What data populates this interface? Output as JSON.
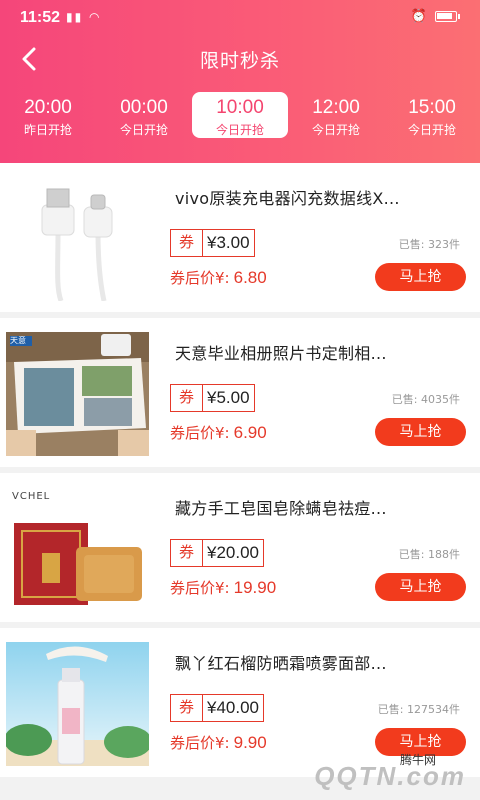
{
  "status_bar": {
    "time": "11:52",
    "signal_icons": "▮▮ ◠"
  },
  "header": {
    "title": "限时秒杀"
  },
  "tabs": [
    {
      "time": "20:00",
      "label": "昨日开抢"
    },
    {
      "time": "00:00",
      "label": "今日开抢"
    },
    {
      "time": "10:00",
      "label": "今日开抢"
    },
    {
      "time": "12:00",
      "label": "今日开抢"
    },
    {
      "time": "15:00",
      "label": "今日开抢"
    }
  ],
  "active_tab": 2,
  "products": [
    {
      "title": "vivo原装充电器闪充数据线X...",
      "coupon_label": "券",
      "coupon_amount": "¥3.00",
      "sold": "已售: 323件",
      "after_label": "券后价¥:",
      "after_price": "6.80",
      "button": "马上抢"
    },
    {
      "title": "天意毕业相册照片书定制相...",
      "coupon_label": "券",
      "coupon_amount": "¥5.00",
      "sold": "已售: 4035件",
      "after_label": "券后价¥:",
      "after_price": "6.90",
      "button": "马上抢"
    },
    {
      "title": "藏方手工皂国皂除螨皂祛痘...",
      "coupon_label": "券",
      "coupon_amount": "¥20.00",
      "sold": "已售: 188件",
      "after_label": "券后价¥:",
      "after_price": "19.90",
      "button": "马上抢"
    },
    {
      "title": "飘丫红石榴防晒霜喷雾面部...",
      "coupon_label": "券",
      "coupon_amount": "¥40.00",
      "sold": "已售: 127534件",
      "after_label": "券后价¥:",
      "after_price": "9.90",
      "button": "马上抢"
    }
  ],
  "thumb_text": {
    "vchel": "VCHEL",
    "album_badge": "天意"
  },
  "watermark": {
    "text": "腾牛网",
    "logo": "QQTN.com"
  },
  "colors": {
    "header_start": "#f5467a",
    "header_end": "#fb6f73",
    "accent_red": "#e5392a",
    "button_red": "#f23b1d"
  }
}
